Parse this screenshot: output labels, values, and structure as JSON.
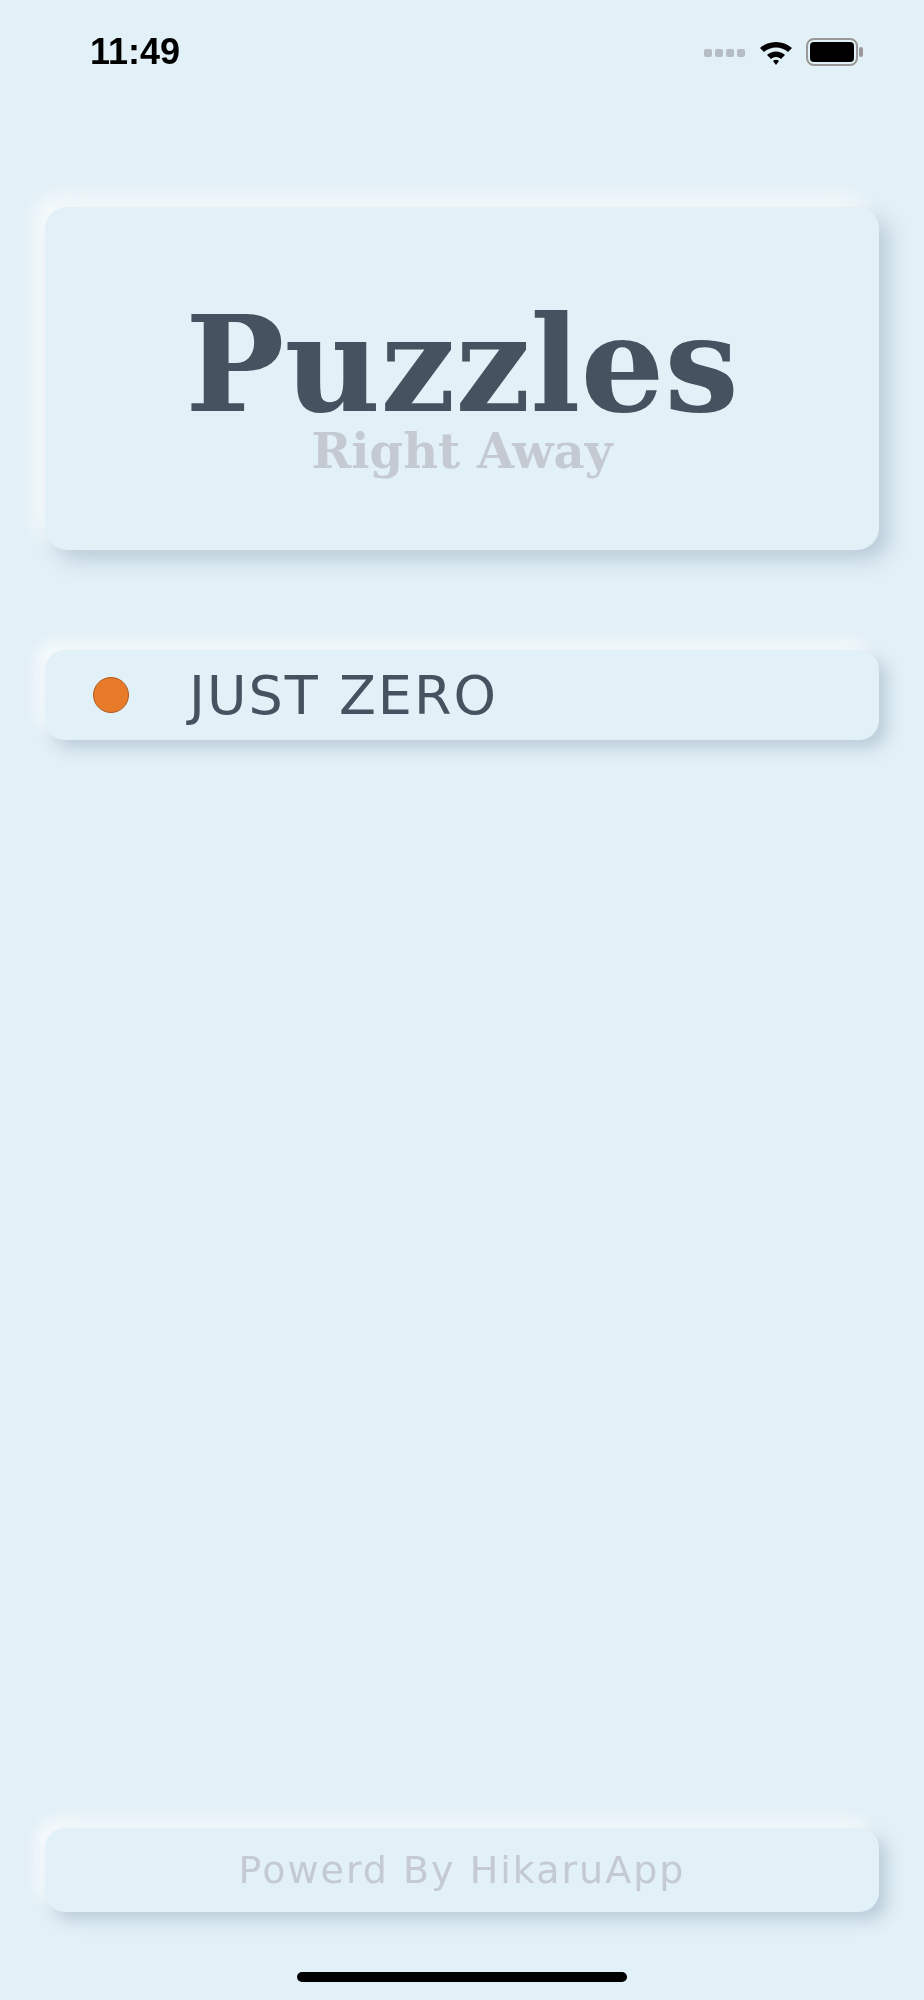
{
  "status_bar": {
    "time": "11:49"
  },
  "header": {
    "title": "Puzzles",
    "subtitle": "Right Away"
  },
  "games": [
    {
      "name": "JUST ZERO",
      "color": "#e87b2a"
    }
  ],
  "footer": {
    "text": "Powerd By HikaruApp"
  }
}
